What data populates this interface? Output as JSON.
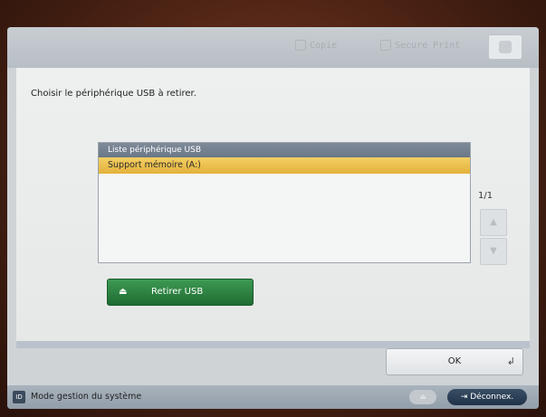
{
  "header": {
    "tab_copie": "Copie",
    "tab_secure_print": "Secure Print"
  },
  "main": {
    "instruction": "Choisir le périphérique USB à retirer.",
    "list": {
      "header": "Liste périphérique USB",
      "items": [
        "Support mémoire (A:)"
      ],
      "selected_index": 0
    },
    "pager": "1/1",
    "retirer_button": "Retirer USB"
  },
  "footer": {
    "ok_button": "OK",
    "mode_text": "Mode gestion du système",
    "id_label": "ID",
    "logout_button": "Déconnex."
  },
  "colors": {
    "selected_row": "#e3b13b",
    "action_green": "#2b7f40",
    "list_header": "#6f7c8c"
  }
}
